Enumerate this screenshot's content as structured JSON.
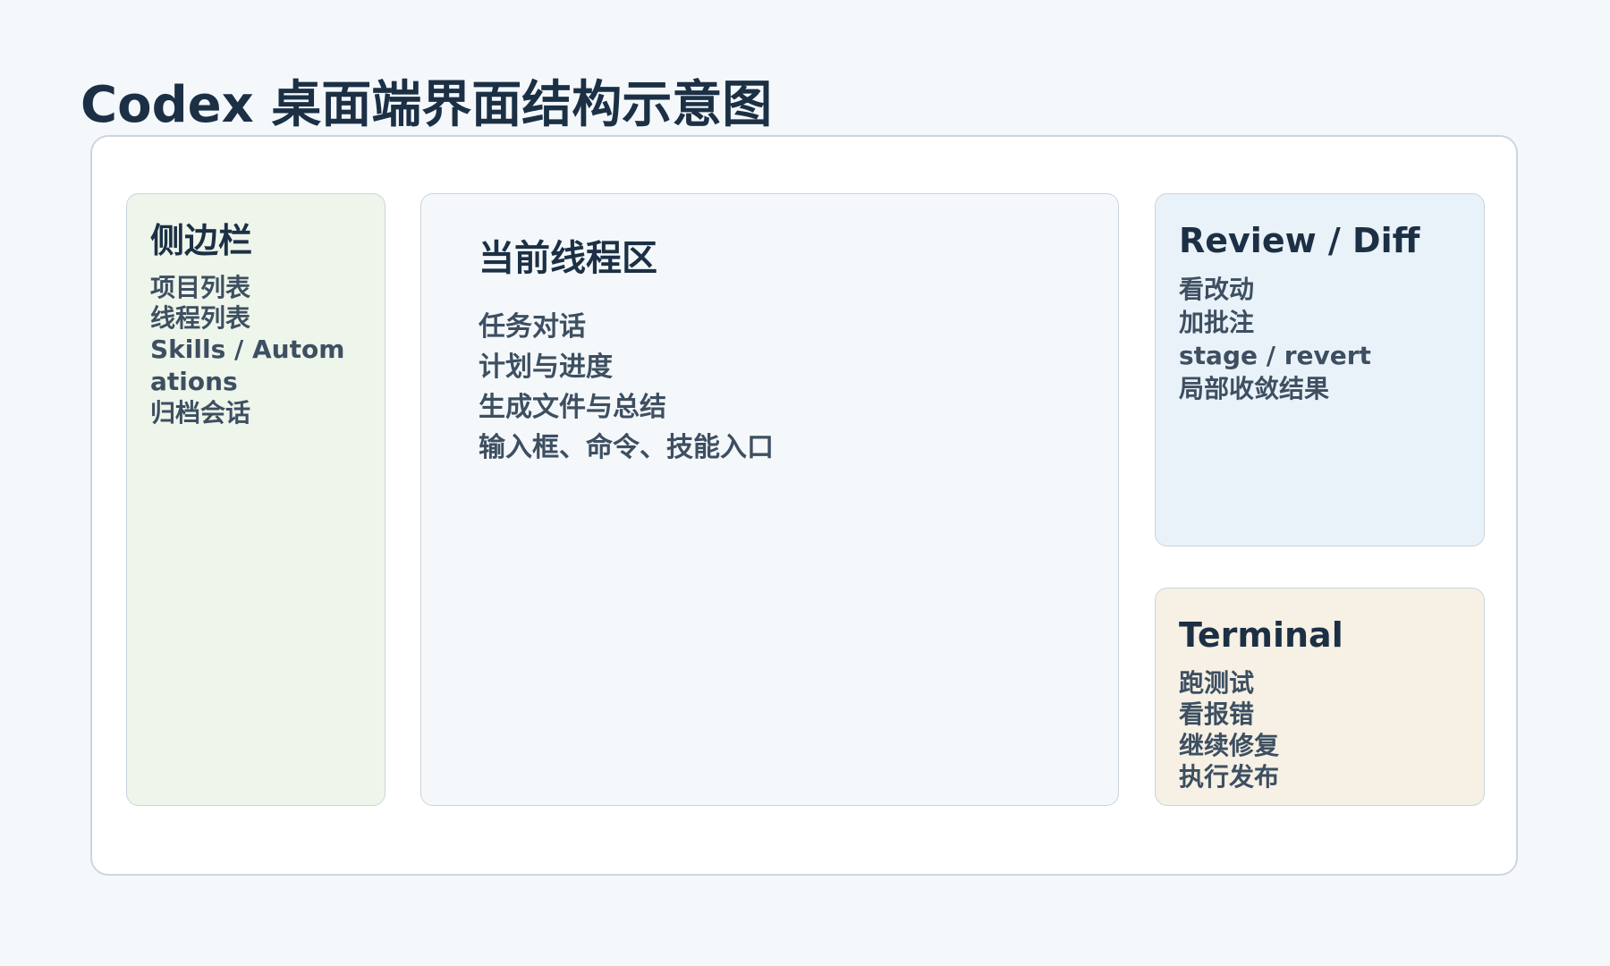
{
  "title": "Codex 桌面端界面结构示意图",
  "panels": {
    "sidebar": {
      "title": "侧边栏",
      "items": [
        "项目列表",
        "线程列表",
        "Skills / Automations",
        "归档会话"
      ]
    },
    "main_thread": {
      "title": "当前线程区",
      "items": [
        "任务对话",
        "计划与进度",
        "生成文件与总结",
        "输入框、命令、技能入口"
      ]
    },
    "review": {
      "title": "Review / Diff",
      "items": [
        "看改动",
        "加批注",
        "stage / revert",
        "局部收敛结果"
      ]
    },
    "terminal": {
      "title": "Terminal",
      "items": [
        "跑测试",
        "看报错",
        "继续修复",
        "执行发布"
      ]
    }
  },
  "colors": {
    "background": "#f5f8fb",
    "title_text": "#1c3045",
    "item_text": "#3d4f61",
    "sidebar_fill": "#eef5ea",
    "main_fill": "#f5f8fb",
    "review_fill": "#eaf2f9",
    "terminal_fill": "#f6f0e5",
    "border": "#c9d4de"
  }
}
